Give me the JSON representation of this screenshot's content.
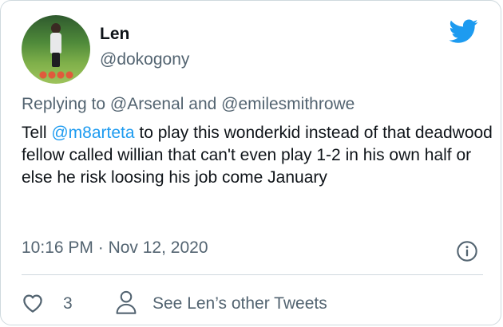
{
  "author": {
    "name": "Len",
    "handle": "@dokogony"
  },
  "reply": {
    "prefix": "Replying to",
    "to_1": "@Arsenal",
    "joiner": "and",
    "to_2": "@emilesmithrowe"
  },
  "tweet": {
    "part_1": "Tell ",
    "mention": "@m8arteta",
    "part_2": " to play this wonderkid instead of that deadwood fellow called willian that can't even play 1-2 in his own half or else he risk loosing his job come January"
  },
  "meta": {
    "time": "10:16 PM",
    "separator": "·",
    "date": "Nov 12, 2020"
  },
  "actions": {
    "like_count": "3",
    "see_more_label": "See Len’s other Tweets"
  },
  "icons": {
    "logo": "twitter-bird-icon",
    "info": "info-icon",
    "like": "heart-icon",
    "profile": "person-icon"
  },
  "colors": {
    "twitter_blue": "#1d9bf0",
    "secondary_text": "#536471",
    "border": "#cfd9de"
  }
}
